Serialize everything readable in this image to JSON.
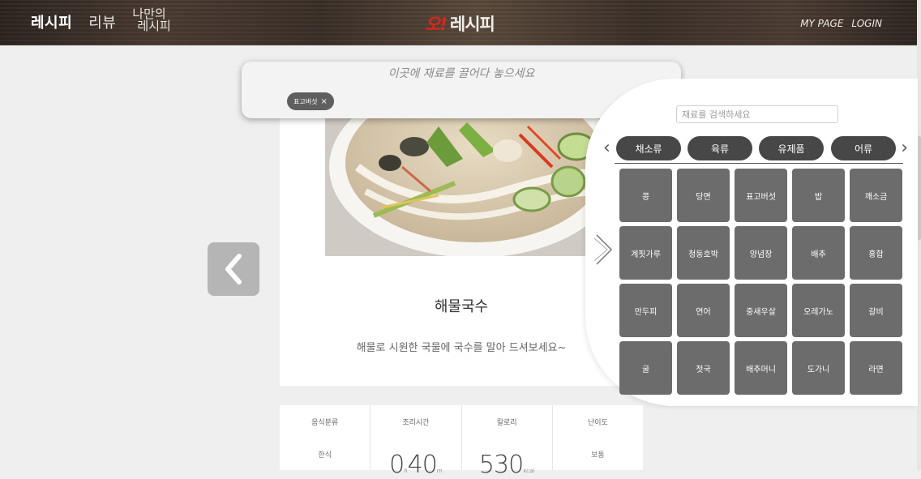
{
  "header": {
    "nav": {
      "recipe": "레시피",
      "review": "리뷰",
      "my_recipe_line1": "나만의",
      "my_recipe_line2": "레시피"
    },
    "logo_o": "오!",
    "logo_text": "레시피",
    "my_page": "MY PAGE",
    "login": "LOGIN"
  },
  "dropzone": {
    "hint": "이곳에 재료를 끌어다 놓으세요",
    "chips": [
      {
        "label": "표고버섯",
        "remove": "×"
      }
    ]
  },
  "recipe": {
    "title": "해물국수",
    "description": "해물로 시원한 국물에 국수를 말아 드셔보세요~"
  },
  "info": {
    "category_label": "음식분류",
    "category_value": "한식",
    "time_label": "조리시간",
    "time_hours": "0",
    "time_hours_unit": "h",
    "time_minutes": "40",
    "time_minutes_unit": "m",
    "calorie_label": "칼로리",
    "calorie_value": "530",
    "calorie_unit": "kcal",
    "difficulty_label": "난이도",
    "difficulty_value": "보통"
  },
  "panel": {
    "search_placeholder": "재료를 검색하세요",
    "categories": [
      "채소류",
      "육류",
      "유제품",
      "어류"
    ],
    "ingredients": [
      "콩",
      "당면",
      "표고버섯",
      "밥",
      "깨소금",
      "계핏가루",
      "청둥호박",
      "양념장",
      "배추",
      "홍합",
      "만두피",
      "연어",
      "중새우살",
      "오레가노",
      "갈비",
      "굴",
      "젓국",
      "배추머니",
      "도가니",
      "라면"
    ]
  },
  "colors": {
    "header": "#3a2e27",
    "logo_accent": "#e0241b",
    "category_button": "#474747",
    "ingredient_tile": "#6c6c6c",
    "chip": "#5f5f5f"
  }
}
